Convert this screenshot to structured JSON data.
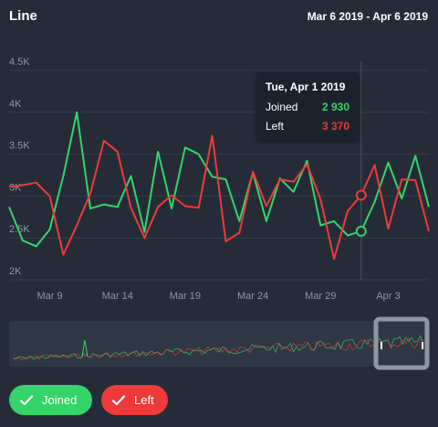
{
  "header": {
    "title": "Line",
    "date_range": "Mar 6 2019 - Apr 6 2019"
  },
  "colors": {
    "joined": "#35d46a",
    "left": "#ee3a3a",
    "background": "#252c38",
    "grid": "#343c4a"
  },
  "tooltip": {
    "date": "Tue, Apr 1 2019",
    "joined_label": "Joined",
    "joined_value": "2 930",
    "left_label": "Left",
    "left_value": "3 370"
  },
  "legend": {
    "joined_label": "Joined",
    "left_label": "Left"
  },
  "chart_data": {
    "type": "line",
    "title": "Line",
    "y_ticks": [
      "4.5K",
      "4K",
      "3.5K",
      "3K",
      "2.5K",
      "2K"
    ],
    "x_ticks": [
      "Mar 9",
      "Mar 14",
      "Mar 19",
      "Mar 24",
      "Mar 29",
      "Apr 3"
    ],
    "ylim": [
      1900,
      4500
    ],
    "x": [
      "Mar 6",
      "Mar 7",
      "Mar 8",
      "Mar 9",
      "Mar 10",
      "Mar 11",
      "Mar 12",
      "Mar 13",
      "Mar 14",
      "Mar 15",
      "Mar 16",
      "Mar 17",
      "Mar 18",
      "Mar 19",
      "Mar 20",
      "Mar 21",
      "Mar 22",
      "Mar 23",
      "Mar 24",
      "Mar 25",
      "Mar 26",
      "Mar 27",
      "Mar 28",
      "Mar 29",
      "Mar 30",
      "Mar 31",
      "Apr 1",
      "Apr 2",
      "Apr 3",
      "Apr 4",
      "Apr 5",
      "Apr 6"
    ],
    "series": [
      {
        "name": "Joined",
        "values": [
          2870,
          2470,
          2400,
          2600,
          3240,
          4000,
          2850,
          2900,
          2870,
          3240,
          2570,
          3530,
          2850,
          3580,
          3500,
          3230,
          3200,
          2700,
          3280,
          2700,
          3210,
          3050,
          3420,
          2650,
          2700,
          2530,
          2580,
          2930,
          3400,
          2970,
          3480,
          2870
        ]
      },
      {
        "name": "Left",
        "values": [
          3110,
          3130,
          3160,
          3000,
          2300,
          2650,
          3030,
          3660,
          3530,
          2860,
          2500,
          2870,
          3010,
          2880,
          2860,
          3720,
          2460,
          2560,
          3290,
          2880,
          3200,
          3170,
          3380,
          2960,
          2250,
          2820,
          3010,
          3370,
          2610,
          3200,
          3190,
          2580
        ]
      }
    ],
    "grid": true,
    "legend_position": "bottom-left"
  }
}
